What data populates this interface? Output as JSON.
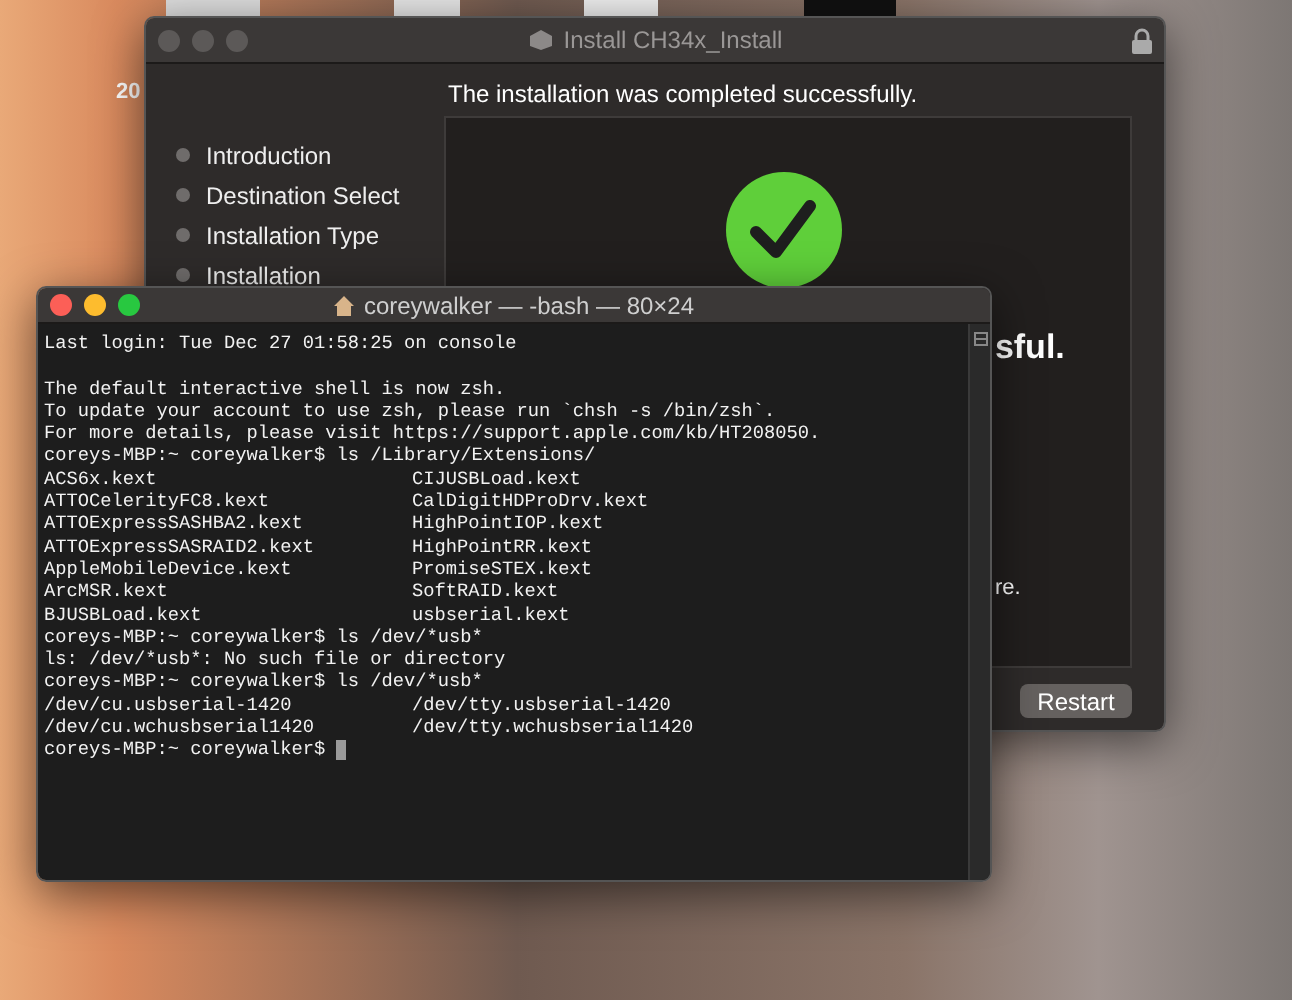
{
  "desktop": {
    "icon_label": "20"
  },
  "installer": {
    "title": "Install CH34x_Install",
    "heading": "The installation was completed successfully.",
    "steps": [
      {
        "label": "Introduction"
      },
      {
        "label": "Destination Select"
      },
      {
        "label": "Installation Type"
      },
      {
        "label": "Installation"
      }
    ],
    "message_fragment": "sful.",
    "note_fragment": "re.",
    "button": "Restart"
  },
  "terminal": {
    "title": "coreywalker — -bash — 80×24",
    "lines": [
      {
        "kind": "text",
        "text": "Last login: Tue Dec 27 01:58:25 on console"
      },
      {
        "kind": "blank"
      },
      {
        "kind": "text",
        "text": "The default interactive shell is now zsh."
      },
      {
        "kind": "text",
        "text": "To update your account to use zsh, please run `chsh -s /bin/zsh`."
      },
      {
        "kind": "text",
        "text": "For more details, please visit https://support.apple.com/kb/HT208050."
      },
      {
        "kind": "text",
        "text": "coreys-MBP:~ coreywalker$ ls /Library/Extensions/"
      },
      {
        "kind": "columns",
        "cells": [
          "ACS6x.kext",
          "CIJUSBLoad.kext"
        ]
      },
      {
        "kind": "columns",
        "cells": [
          "ATTOCelerityFC8.kext",
          "CalDigitHDProDrv.kext"
        ]
      },
      {
        "kind": "columns",
        "cells": [
          "ATTOExpressSASHBA2.kext",
          "HighPointIOP.kext"
        ]
      },
      {
        "kind": "columns",
        "cells": [
          "ATTOExpressSASRAID2.kext",
          "HighPointRR.kext"
        ]
      },
      {
        "kind": "columns",
        "cells": [
          "AppleMobileDevice.kext",
          "PromiseSTEX.kext"
        ]
      },
      {
        "kind": "columns",
        "cells": [
          "ArcMSR.kext",
          "SoftRAID.kext"
        ]
      },
      {
        "kind": "columns",
        "cells": [
          "BJUSBLoad.kext",
          "usbserial.kext"
        ]
      },
      {
        "kind": "text",
        "text": "coreys-MBP:~ coreywalker$ ls /dev/*usb*"
      },
      {
        "kind": "text",
        "text": "ls: /dev/*usb*: No such file or directory"
      },
      {
        "kind": "text",
        "text": "coreys-MBP:~ coreywalker$ ls /dev/*usb*"
      },
      {
        "kind": "columns",
        "cells": [
          "/dev/cu.usbserial-1420",
          "/dev/tty.usbserial-1420"
        ]
      },
      {
        "kind": "columns",
        "cells": [
          "/dev/cu.wchusbserial1420",
          "/dev/tty.wchusbserial1420"
        ]
      },
      {
        "kind": "prompt",
        "text": "coreys-MBP:~ coreywalker$"
      }
    ]
  }
}
